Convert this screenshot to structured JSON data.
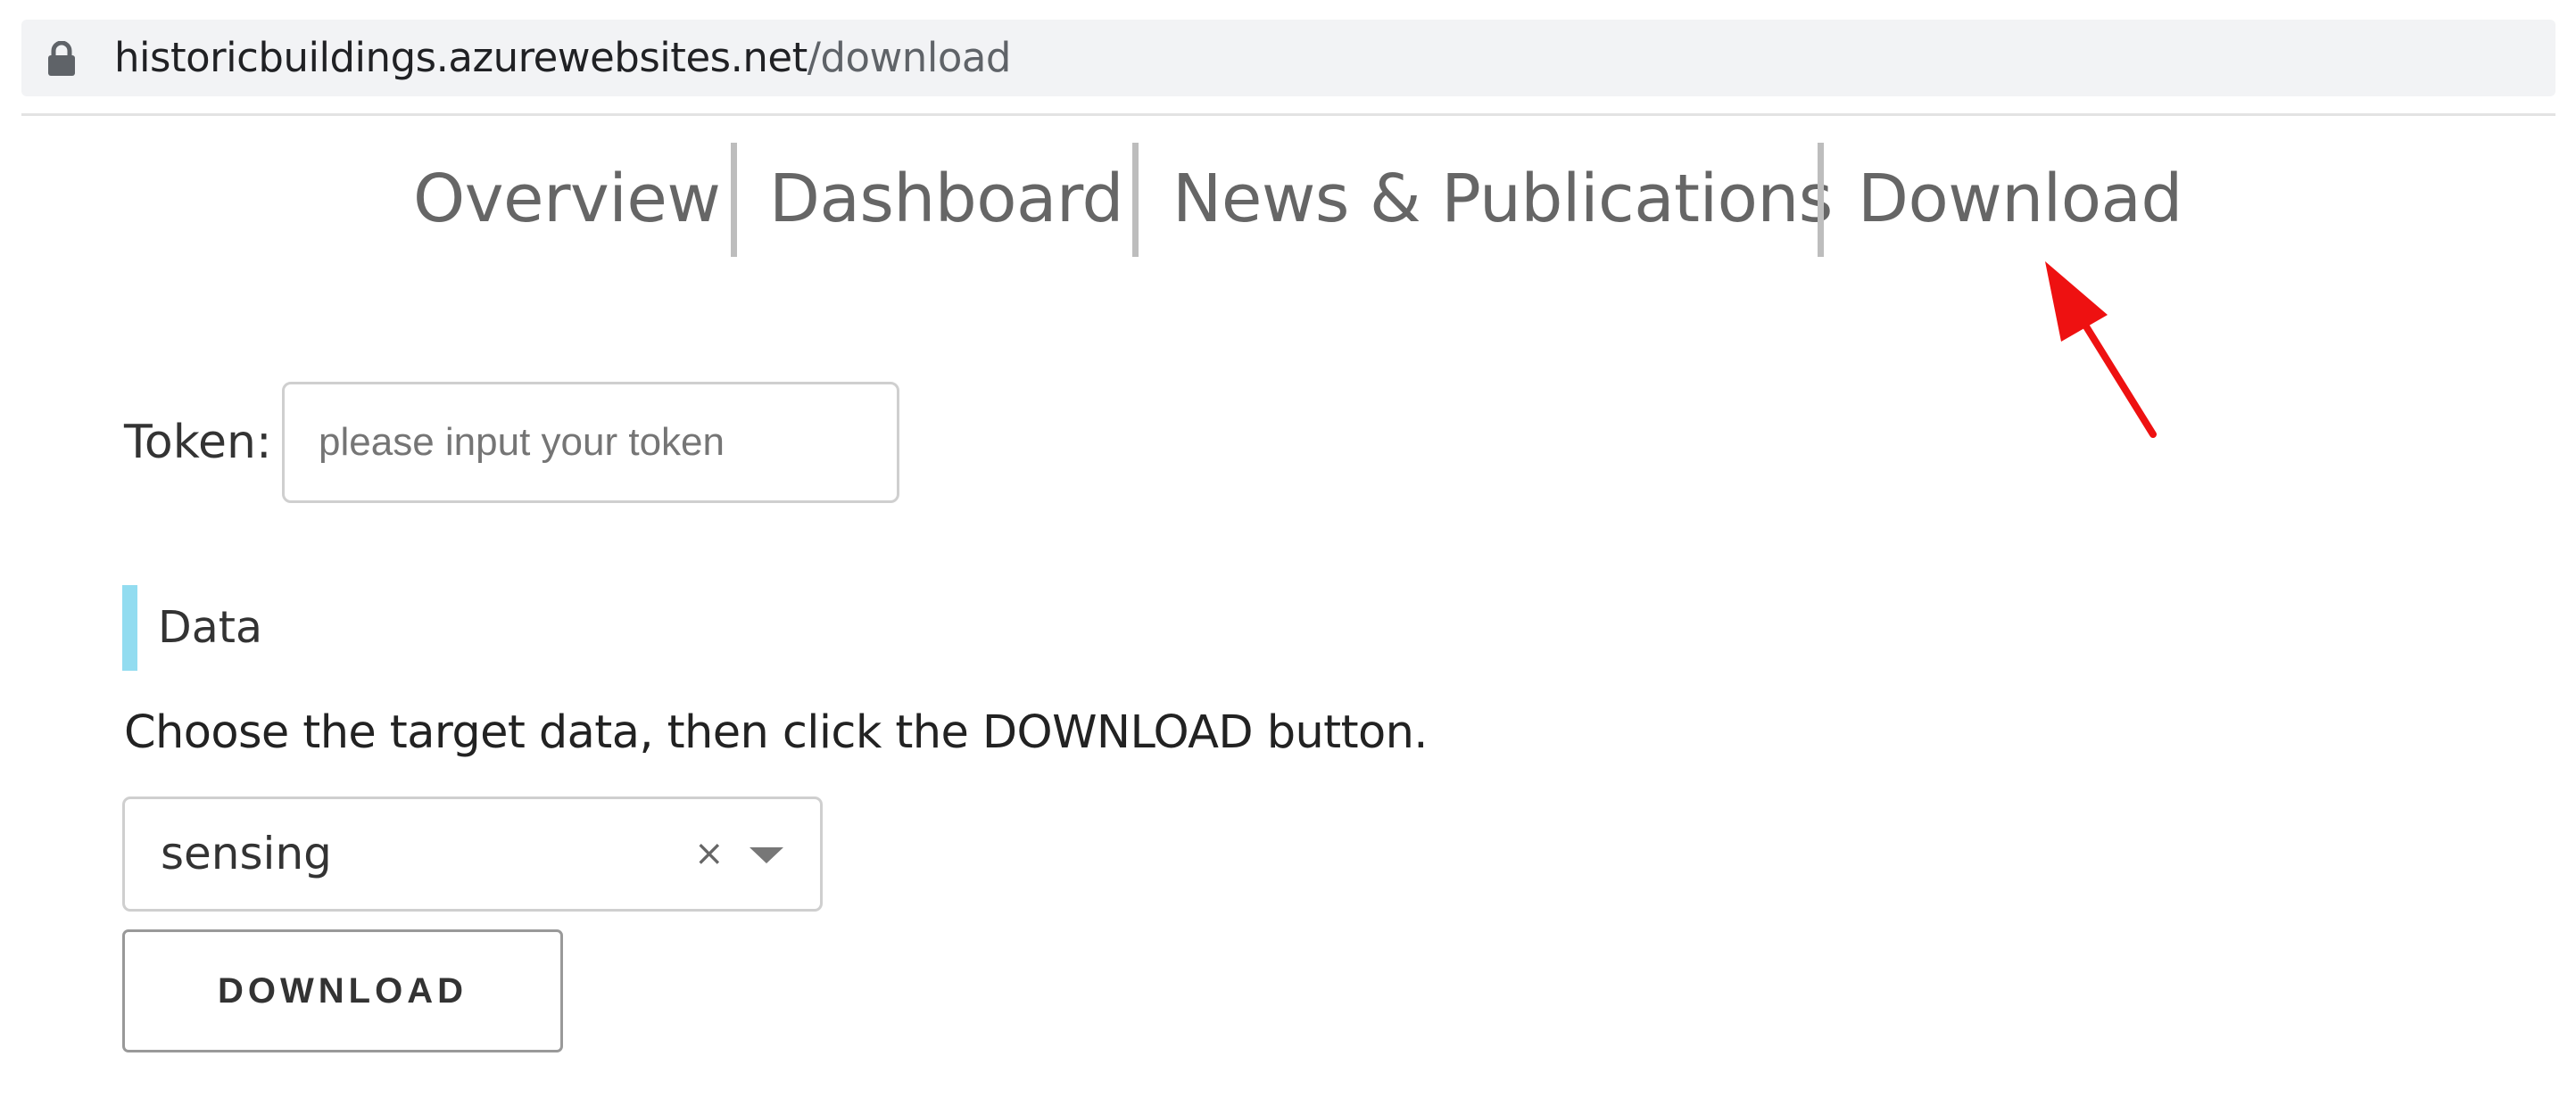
{
  "browser": {
    "url_host": "historicbuildings.azurewebsites.net",
    "url_path": "/download",
    "lock_icon": "lock-icon"
  },
  "nav": {
    "items": [
      {
        "label": "Overview"
      },
      {
        "label": "Dashboard"
      },
      {
        "label": "News & Publications"
      },
      {
        "label": "Download"
      }
    ]
  },
  "annotation": {
    "arrow_icon": "arrow-icon",
    "color": "#ee1111"
  },
  "token": {
    "label": "Token:",
    "placeholder": "please input your token",
    "value": ""
  },
  "data_section": {
    "title": "Data",
    "accent_color": "#92dcf0",
    "instructions": "Choose the target data, then click the DOWNLOAD button.",
    "select": {
      "selected_value": "sensing",
      "clear_glyph": "×",
      "clear_icon": "close-icon",
      "caret_icon": "chevron-down-icon"
    },
    "download_label": "DOWNLOAD"
  }
}
